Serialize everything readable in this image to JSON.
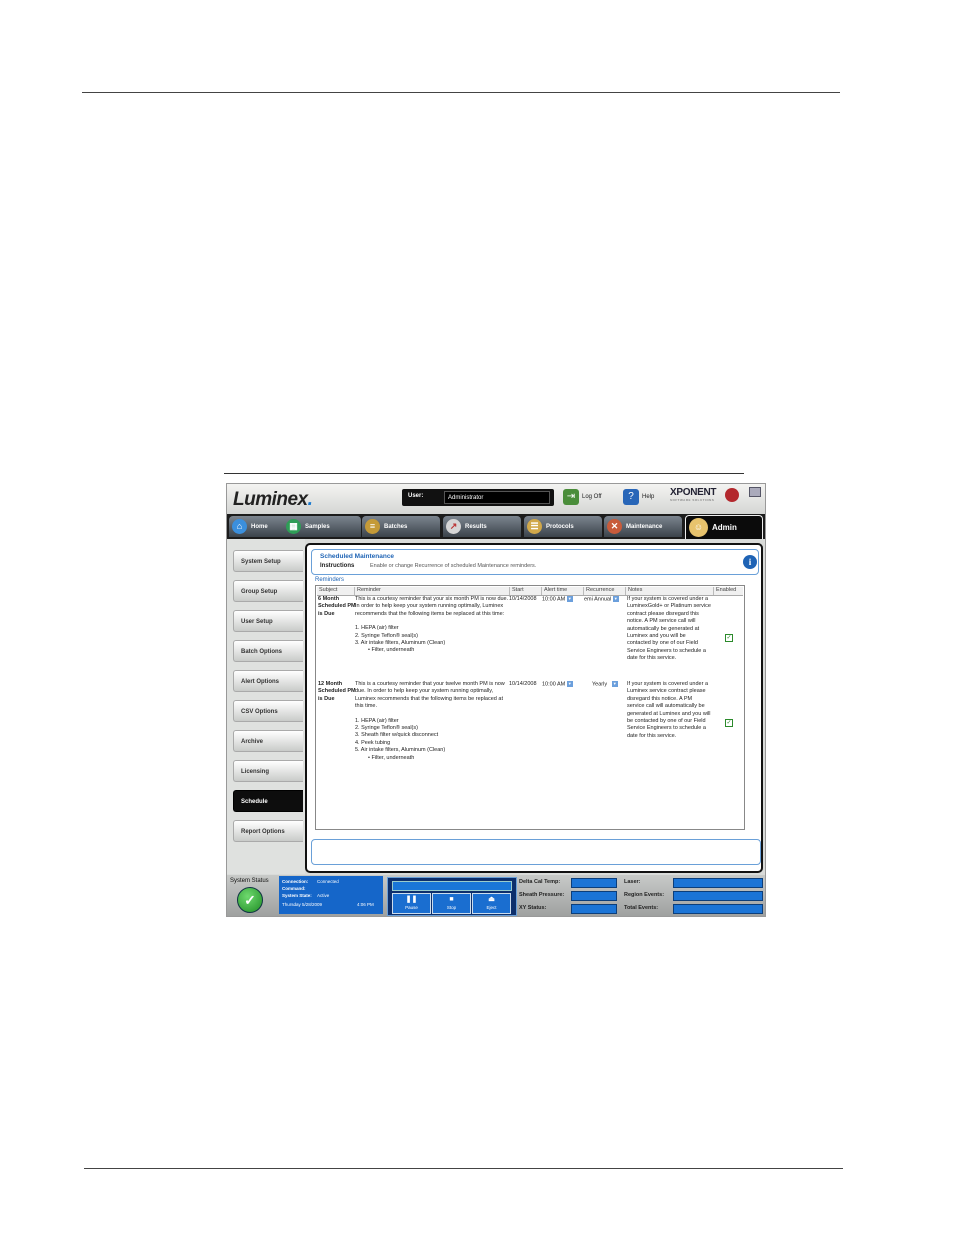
{
  "app": {
    "logo": "Luminex",
    "user_label": "User:",
    "user_value": "Administrator",
    "logoff_label": "Log Off",
    "help_label": "Help",
    "brand": "XPONENT",
    "brand_sub": "SOFTWARE SOLUTIONS"
  },
  "tabs": [
    {
      "label": "Home"
    },
    {
      "label": "Samples"
    },
    {
      "label": "Batches"
    },
    {
      "label": "Results"
    },
    {
      "label": "Protocols"
    },
    {
      "label": "Maintenance"
    },
    {
      "label": "Admin"
    }
  ],
  "sidebar": [
    {
      "label": "System Setup"
    },
    {
      "label": "Group Setup"
    },
    {
      "label": "User Setup"
    },
    {
      "label": "Batch Options"
    },
    {
      "label": "Alert Options"
    },
    {
      "label": "CSV Options"
    },
    {
      "label": "Archive"
    },
    {
      "label": "Licensing"
    },
    {
      "label": "Schedule"
    },
    {
      "label": "Report Options"
    }
  ],
  "header": {
    "title": "Scheduled Maintenance",
    "instructions_label": "Instructions",
    "instructions_text": "Enable or change Recurrence of scheduled Maintenance reminders."
  },
  "reminders": {
    "label": "Reminders",
    "columns": [
      "Subject",
      "Reminder",
      "Start",
      "Alert time",
      "Recurrence",
      "Notes",
      "Enabled"
    ],
    "rows": [
      {
        "subject": "6 Month Scheduled PM is Due",
        "reminder_intro": "This is a courtesy reminder that your six month PM is now due. In order to help keep your system running optimally, Luminex recommends that the following items be replaced at this time:",
        "items": [
          "1.      HEPA (air) filter",
          "2.      Syringe Teflon® seal(s)",
          "3.      Air intake filters, Aluminum (Clean)",
          "• Filter, underneath"
        ],
        "start": "10/14/2008",
        "alert_time": "10:00 AM",
        "recurrence": "emi Annual",
        "notes": "If your system is covered under a LuminexGold+ or Platinum service contract please disregard this notice. A PM service call will automatically be generated at Luminex and you will be contacted by one of our Field Service Engineers to schedule a date for this service.",
        "enabled": true
      },
      {
        "subject": "12 Month Scheduled PM is Due",
        "reminder_intro": "This is a courtesy reminder that your twelve month PM is now due. In order to help keep your system running optimally, Luminex recommends that the following items be replaced at this time.",
        "items": [
          "1.      HEPA (air) filter",
          "2.      Syringe Teflon® seal(s)",
          "3.      Sheath filter w/quick disconnect",
          "4.      Peek tubing",
          "5.      Air intake filters, Aluminum (Clean)",
          "• Filter, underneath"
        ],
        "start": "10/14/2008",
        "alert_time": "10:00 AM",
        "recurrence": "Yearly",
        "notes": "If your system is covered under a Luminex service contract please disregard this notice. A PM service call will automatically be generated at Luminex and you will be contacted by one of our Field Service Engineers to schedule a date for this service.",
        "enabled": true
      }
    ]
  },
  "status": {
    "title": "System Status",
    "connection_label": "Connection:",
    "connection_value": "Connected",
    "command_label": "Command:",
    "state_label": "System State:",
    "state_value": "Active",
    "date": "Thursday 5/28/2009",
    "time": "4:06 PM"
  },
  "controls": [
    {
      "label": "Pause",
      "icon": "pause-icon"
    },
    {
      "label": "Stop",
      "icon": "stop-icon"
    },
    {
      "label": "Eject",
      "icon": "eject-icon"
    }
  ],
  "meters": {
    "delta_cal_temp": "Delta Cal Temp:",
    "sheath_pressure": "Sheath Pressure:",
    "xy_status": "XY Status:",
    "laser": "Laser:",
    "region_events": "Region Events:",
    "total_events": "Total Events:"
  },
  "colors": {
    "accent_blue": "#1f64b5",
    "status_blue": "#1566c9",
    "tab_dark": "#1c1c1c",
    "ok_green": "#2b8a2b"
  }
}
